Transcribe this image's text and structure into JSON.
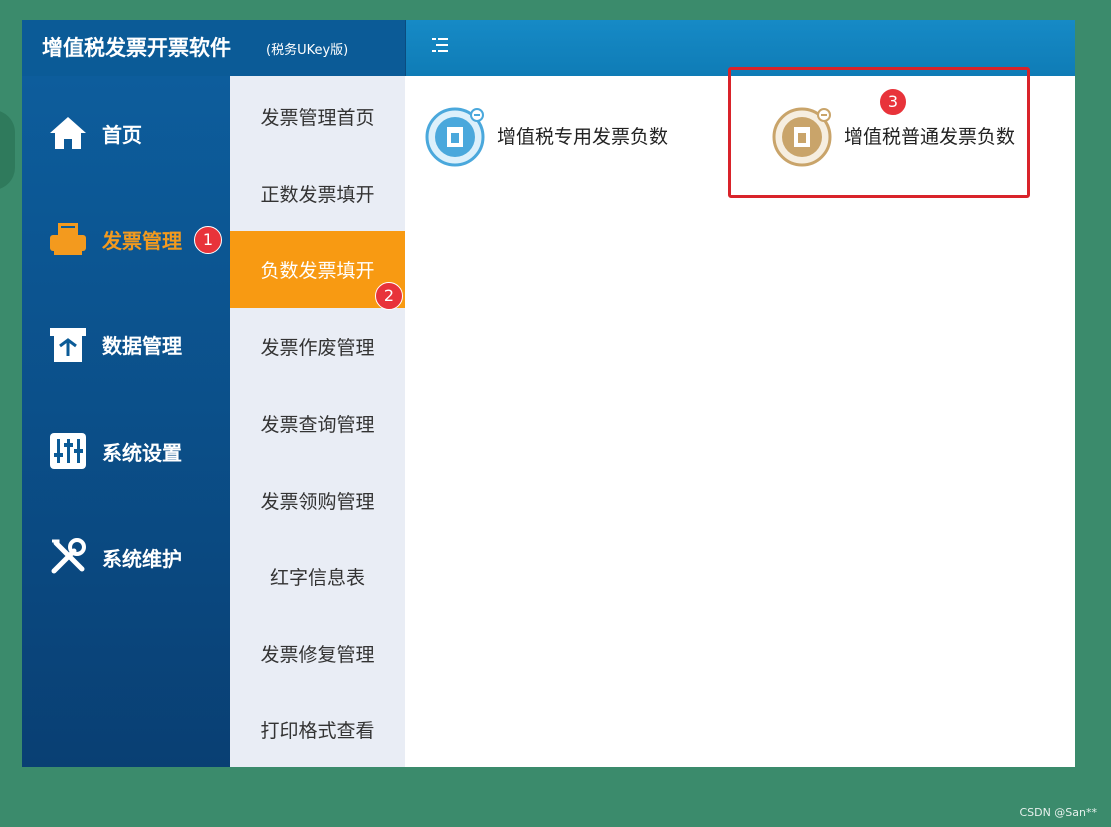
{
  "app": {
    "title": "增值税发票开票软件",
    "subtitle": "(税务UKey版)"
  },
  "sidebar": {
    "items": [
      {
        "label": "首页",
        "icon": "home-icon"
      },
      {
        "label": "发票管理",
        "icon": "printer-icon",
        "active": true
      },
      {
        "label": "数据管理",
        "icon": "data-icon"
      },
      {
        "label": "系统设置",
        "icon": "sliders-icon"
      },
      {
        "label": "系统维护",
        "icon": "tools-icon"
      }
    ]
  },
  "submenu": {
    "items": [
      {
        "label": "发票管理首页"
      },
      {
        "label": "正数发票填开"
      },
      {
        "label": "负数发票填开",
        "active": true
      },
      {
        "label": "发票作废管理"
      },
      {
        "label": "发票查询管理"
      },
      {
        "label": "发票领购管理"
      },
      {
        "label": "红字信息表"
      },
      {
        "label": "发票修复管理"
      },
      {
        "label": "打印格式查看"
      }
    ]
  },
  "content": {
    "options": [
      {
        "label": "增值税专用发票负数",
        "icon": "special-invoice-icon",
        "color": "#4aa8dc"
      },
      {
        "label": "增值税普通发票负数",
        "icon": "general-invoice-icon",
        "color": "#c9a46a"
      }
    ]
  },
  "annotations": {
    "badge_1": "1",
    "badge_2": "2",
    "badge_3": "3"
  },
  "watermark": "CSDN @San**",
  "colors": {
    "accent": "#f89a12",
    "header": "#0b5b97",
    "highlight": "#d9232a"
  }
}
